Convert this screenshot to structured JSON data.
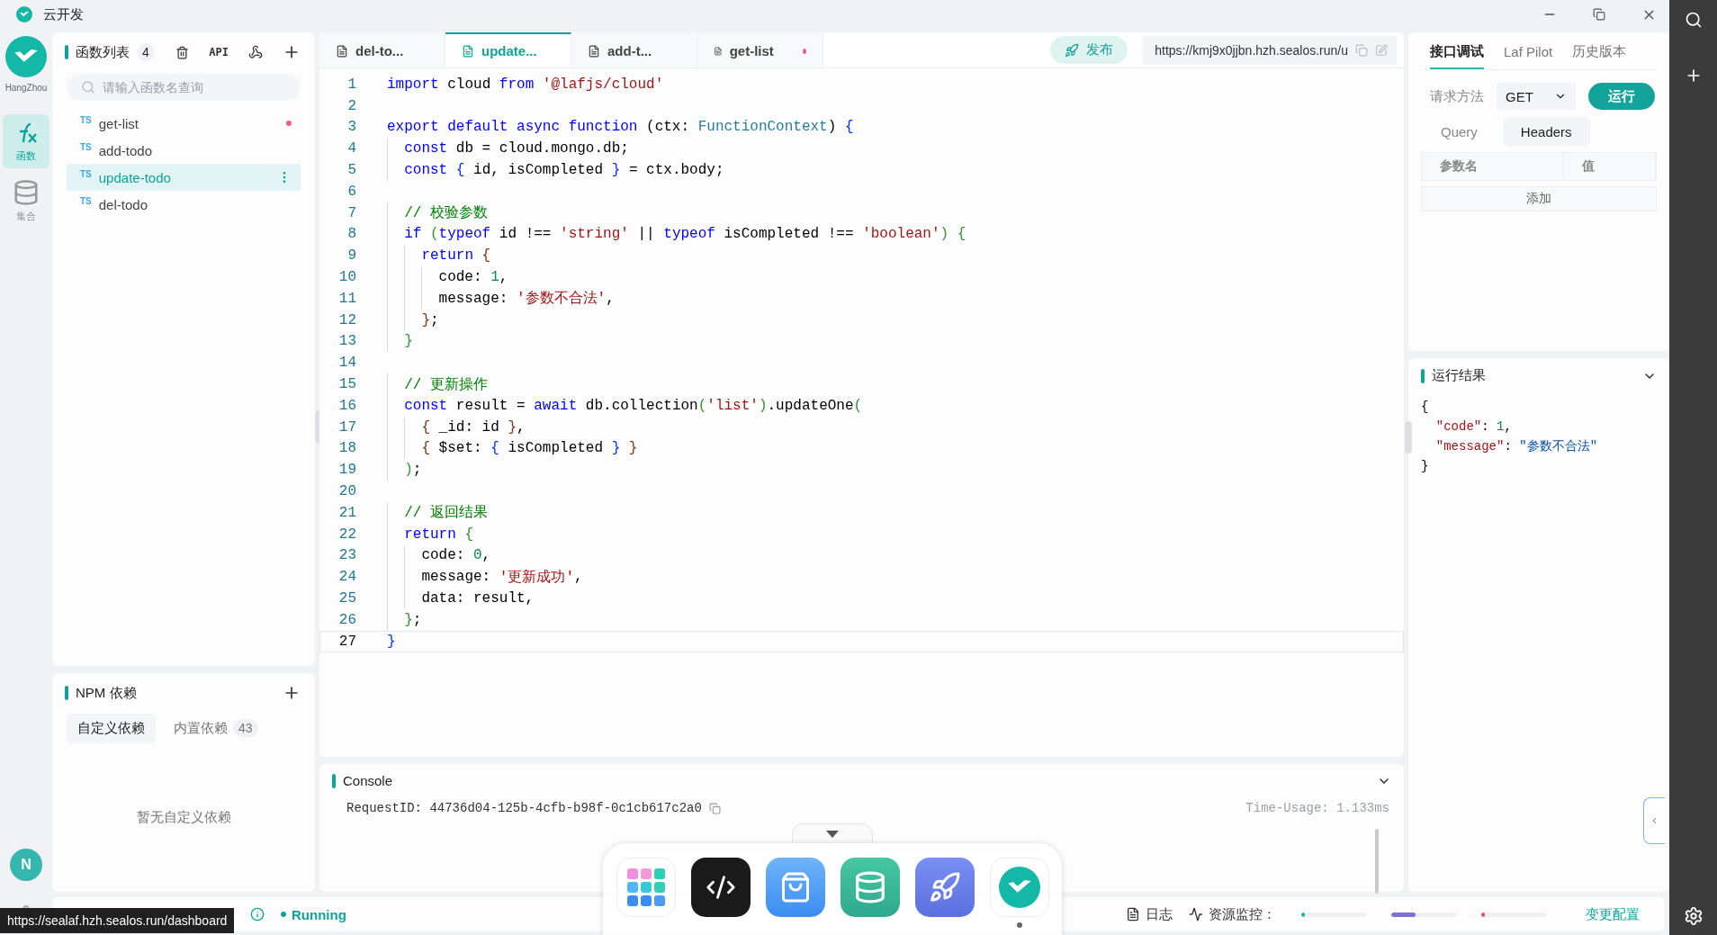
{
  "app": {
    "title": "云开发"
  },
  "rail": {
    "region": "HangZhou",
    "items": [
      {
        "kind": "function",
        "label": "函数",
        "selected": true
      },
      {
        "kind": "database",
        "label": "集合",
        "selected": false
      }
    ],
    "avatar": "N"
  },
  "functions": {
    "title": "函数列表",
    "count": "4",
    "api": "API",
    "search": {
      "placeholder": "请输入函数名查询"
    },
    "items": [
      {
        "lang": "TS",
        "name": "get-list",
        "selected": false,
        "modified": true
      },
      {
        "lang": "TS",
        "name": "add-todo",
        "selected": false,
        "modified": false
      },
      {
        "lang": "TS",
        "name": "update-todo",
        "selected": true,
        "modified": false
      },
      {
        "lang": "TS",
        "name": "del-todo",
        "selected": false,
        "modified": false
      }
    ]
  },
  "npm": {
    "title": "NPM 依赖",
    "tabs": [
      {
        "label": "自定义依赖",
        "selected": true
      },
      {
        "label": "内置依赖",
        "count": "43",
        "selected": false
      }
    ],
    "empty": "暂无自定义依赖"
  },
  "editor": {
    "tabs": [
      {
        "label": "del-to...",
        "selected": false,
        "modified": false
      },
      {
        "label": "update...",
        "selected": true,
        "modified": false
      },
      {
        "label": "add-t...",
        "selected": false,
        "modified": false
      },
      {
        "label": "get-list",
        "selected": false,
        "modified": true
      }
    ],
    "publish": "发布",
    "url": "https://kmj9x0jjbn.hzh.sealos.run/u",
    "lines": [
      {
        "n": "1",
        "active": false,
        "tokens": [
          {
            "text": "import",
            "kind": "kw"
          },
          {
            "text": " cloud ",
            "kind": "p"
          },
          {
            "text": "from",
            "kind": "kw"
          },
          {
            "text": " '@lafjs/cloud'",
            "kind": "s"
          }
        ]
      },
      {
        "n": "2",
        "active": false
      },
      {
        "n": "3",
        "active": false,
        "tokens": [
          {
            "text": "export default async function",
            "kind": "kw"
          },
          {
            "text": " (ctx: ",
            "kind": "p"
          },
          {
            "text": "FunctionContext",
            "kind": "t"
          },
          {
            "text": ") ",
            "kind": "p"
          },
          {
            "text": "{",
            "kind": "b1"
          }
        ]
      },
      {
        "n": "4",
        "active": false,
        "tokens": [
          {
            "text": "  const",
            "kind": "kw"
          },
          {
            "text": " db = cloud.mongo.db;",
            "kind": "p"
          }
        ]
      },
      {
        "n": "5",
        "active": false,
        "tokens": [
          {
            "text": "  const",
            "kind": "kw"
          },
          {
            "text": " {",
            "kind": "b1"
          },
          {
            "text": " id, isCompleted ",
            "kind": "p"
          },
          {
            "text": "}",
            "kind": "b1"
          },
          {
            "text": " = ctx.body;",
            "kind": "p"
          }
        ]
      },
      {
        "n": "6",
        "active": false
      },
      {
        "n": "7",
        "active": false,
        "tokens": [
          {
            "text": "  // 校验参数",
            "kind": "c"
          }
        ]
      },
      {
        "n": "8",
        "active": false,
        "tokens": [
          {
            "text": "  if",
            "kind": "kw"
          },
          {
            "text": " (",
            "kind": "b2"
          },
          {
            "text": "typeof",
            "kind": "kw"
          },
          {
            "text": " id !== ",
            "kind": "p"
          },
          {
            "text": "'string'",
            "kind": "s"
          },
          {
            "text": " || ",
            "kind": "p"
          },
          {
            "text": "typeof",
            "kind": "kw"
          },
          {
            "text": " isCompleted !== ",
            "kind": "p"
          },
          {
            "text": "'boolean'",
            "kind": "s"
          },
          {
            "text": ")",
            "kind": "b2"
          },
          {
            "text": " {",
            "kind": "b2"
          }
        ]
      },
      {
        "n": "9",
        "active": false,
        "tokens": [
          {
            "text": "    return",
            "kind": "kw"
          },
          {
            "text": " {",
            "kind": "b3"
          }
        ]
      },
      {
        "n": "10",
        "active": false,
        "tokens": [
          {
            "text": "      code: ",
            "kind": "p"
          },
          {
            "text": "1",
            "kind": "n"
          },
          {
            "text": ",",
            "kind": "p"
          }
        ]
      },
      {
        "n": "11",
        "active": false,
        "tokens": [
          {
            "text": "      message: ",
            "kind": "p"
          },
          {
            "text": "'参数不合法'",
            "kind": "s"
          },
          {
            "text": ",",
            "kind": "p"
          }
        ]
      },
      {
        "n": "12",
        "active": false,
        "tokens": [
          {
            "text": "    }",
            "kind": "b3"
          },
          {
            "text": ";",
            "kind": "p"
          }
        ]
      },
      {
        "n": "13",
        "active": false,
        "tokens": [
          {
            "text": "  }",
            "kind": "b2"
          }
        ]
      },
      {
        "n": "14",
        "active": false
      },
      {
        "n": "15",
        "active": false,
        "tokens": [
          {
            "text": "  // 更新操作",
            "kind": "c"
          }
        ]
      },
      {
        "n": "16",
        "active": false,
        "tokens": [
          {
            "text": "  const",
            "kind": "kw"
          },
          {
            "text": " result = ",
            "kind": "p"
          },
          {
            "text": "await",
            "kind": "kw"
          },
          {
            "text": " db.collection",
            "kind": "p"
          },
          {
            "text": "(",
            "kind": "b2"
          },
          {
            "text": "'list'",
            "kind": "s"
          },
          {
            "text": ")",
            "kind": "b2"
          },
          {
            "text": ".updateOne",
            "kind": "p"
          },
          {
            "text": "(",
            "kind": "b2"
          }
        ]
      },
      {
        "n": "17",
        "active": false,
        "tokens": [
          {
            "text": "    {",
            "kind": "b3"
          },
          {
            "text": " _id: id ",
            "kind": "p"
          },
          {
            "text": "}",
            "kind": "b3"
          },
          {
            "text": ",",
            "kind": "p"
          }
        ]
      },
      {
        "n": "18",
        "active": false,
        "tokens": [
          {
            "text": "    {",
            "kind": "b3"
          },
          {
            "text": " $set: ",
            "kind": "p"
          },
          {
            "text": "{",
            "kind": "b1"
          },
          {
            "text": " isCompleted ",
            "kind": "p"
          },
          {
            "text": "}",
            "kind": "b1"
          },
          {
            "text": " }",
            "kind": "b3"
          }
        ]
      },
      {
        "n": "19",
        "active": false,
        "tokens": [
          {
            "text": "  )",
            "kind": "b2"
          },
          {
            "text": ";",
            "kind": "p"
          }
        ]
      },
      {
        "n": "20",
        "active": false
      },
      {
        "n": "21",
        "active": false,
        "tokens": [
          {
            "text": "  // 返回结果",
            "kind": "c"
          }
        ]
      },
      {
        "n": "22",
        "active": false,
        "tokens": [
          {
            "text": "  return",
            "kind": "kw"
          },
          {
            "text": " {",
            "kind": "b2"
          }
        ]
      },
      {
        "n": "23",
        "active": false,
        "tokens": [
          {
            "text": "    code: ",
            "kind": "p"
          },
          {
            "text": "0",
            "kind": "n"
          },
          {
            "text": ",",
            "kind": "p"
          }
        ]
      },
      {
        "n": "24",
        "active": false,
        "tokens": [
          {
            "text": "    message: ",
            "kind": "p"
          },
          {
            "text": "'更新成功'",
            "kind": "s"
          },
          {
            "text": ",",
            "kind": "p"
          }
        ]
      },
      {
        "n": "25",
        "active": false,
        "tokens": [
          {
            "text": "    data: result,",
            "kind": "p"
          }
        ]
      },
      {
        "n": "26",
        "active": false,
        "tokens": [
          {
            "text": "  }",
            "kind": "b2"
          },
          {
            "text": ";",
            "kind": "p"
          }
        ]
      },
      {
        "n": "27",
        "active": true,
        "tokens": [
          {
            "text": "}",
            "kind": "b1"
          }
        ]
      }
    ]
  },
  "console": {
    "title": "Console",
    "request_id": "RequestID: 44736d04-125b-4cfb-b98f-0c1cb617c2a0",
    "time": "Time-Usage: 1.133ms"
  },
  "debug": {
    "tabs": [
      {
        "label": "接口调试",
        "selected": true
      },
      {
        "label": "Laf Pilot",
        "selected": false
      },
      {
        "label": "历史版本",
        "selected": false
      }
    ],
    "method_label": "请求方法",
    "method": "GET",
    "run": "运行",
    "param_tabs": [
      {
        "label": "Query",
        "selected": false
      },
      {
        "label": "Headers",
        "selected": true
      }
    ],
    "columns": [
      "参数名",
      "值"
    ],
    "add": "添加"
  },
  "result": {
    "title": "运行结果",
    "lines": [
      [
        {
          "text": "{",
          "kind": "p"
        }
      ],
      [
        {
          "text": "  \"code\"",
          "kind": "key"
        },
        {
          "text": ": ",
          "kind": "p"
        },
        {
          "text": "1",
          "kind": "n"
        },
        {
          "text": ",",
          "kind": "p"
        }
      ],
      [
        {
          "text": "  \"message\"",
          "kind": "key"
        },
        {
          "text": ": ",
          "kind": "p"
        },
        {
          "text": "\"参数不合法\"",
          "kind": "js"
        }
      ],
      [
        {
          "text": "}",
          "kind": "p"
        }
      ]
    ]
  },
  "status": {
    "state": "Running",
    "log": "日志",
    "monitor": "资源监控：",
    "meters": [
      {
        "level": 0.02,
        "color": "#14b8a6"
      },
      {
        "level": 0.37,
        "color": "#7f6fd8"
      },
      {
        "level": 0.03,
        "color": "#e8467c"
      }
    ],
    "config": "变更配置"
  },
  "dock": {
    "apps": [
      {
        "kind": "launcher",
        "running": false
      },
      {
        "kind": "code",
        "running": false
      },
      {
        "kind": "store",
        "running": false
      },
      {
        "kind": "database",
        "running": false
      },
      {
        "kind": "rocket",
        "running": false
      },
      {
        "kind": "laf",
        "running": true
      }
    ]
  },
  "tooltip": "https://sealaf.hzh.sealos.run/dashboard"
}
